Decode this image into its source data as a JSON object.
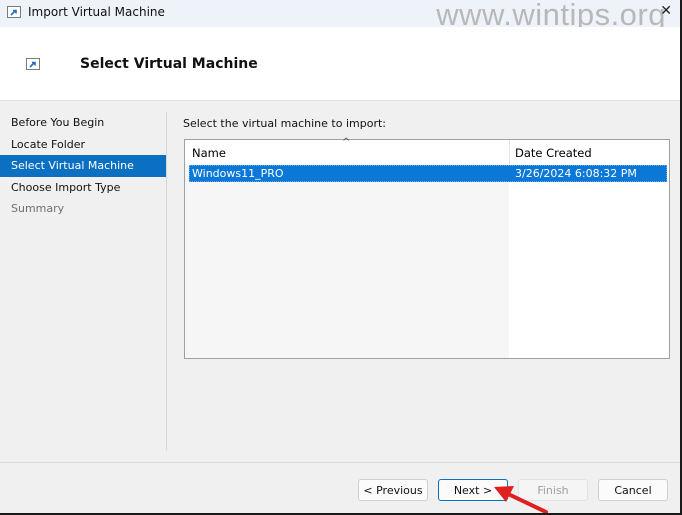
{
  "window": {
    "title": "Import Virtual Machine",
    "watermark": "www.wintips.org",
    "close_glyph": "✕"
  },
  "header": {
    "title": "Select Virtual Machine",
    "icon": "import-vm-icon"
  },
  "nav": {
    "items": [
      {
        "label": "Before You Begin",
        "state": "normal"
      },
      {
        "label": "Locate Folder",
        "state": "normal"
      },
      {
        "label": "Select Virtual Machine",
        "state": "selected"
      },
      {
        "label": "Choose Import Type",
        "state": "normal"
      },
      {
        "label": "Summary",
        "state": "disabled"
      }
    ]
  },
  "main": {
    "prompt": "Select the virtual machine to import:",
    "list": {
      "columns": [
        "Name",
        "Date Created"
      ],
      "sort_indicator": "^",
      "rows": [
        {
          "name": "Windows11_PRO",
          "date_created": "3/26/2024 6:08:32 PM",
          "selected": true
        }
      ]
    }
  },
  "buttons": {
    "previous": "< Previous",
    "next": "Next >",
    "finish": "Finish",
    "cancel": "Cancel"
  },
  "colors": {
    "selection": "#0b78d7",
    "nav_selected": "#0b6fc2",
    "annotation_arrow": "#e0201f"
  }
}
